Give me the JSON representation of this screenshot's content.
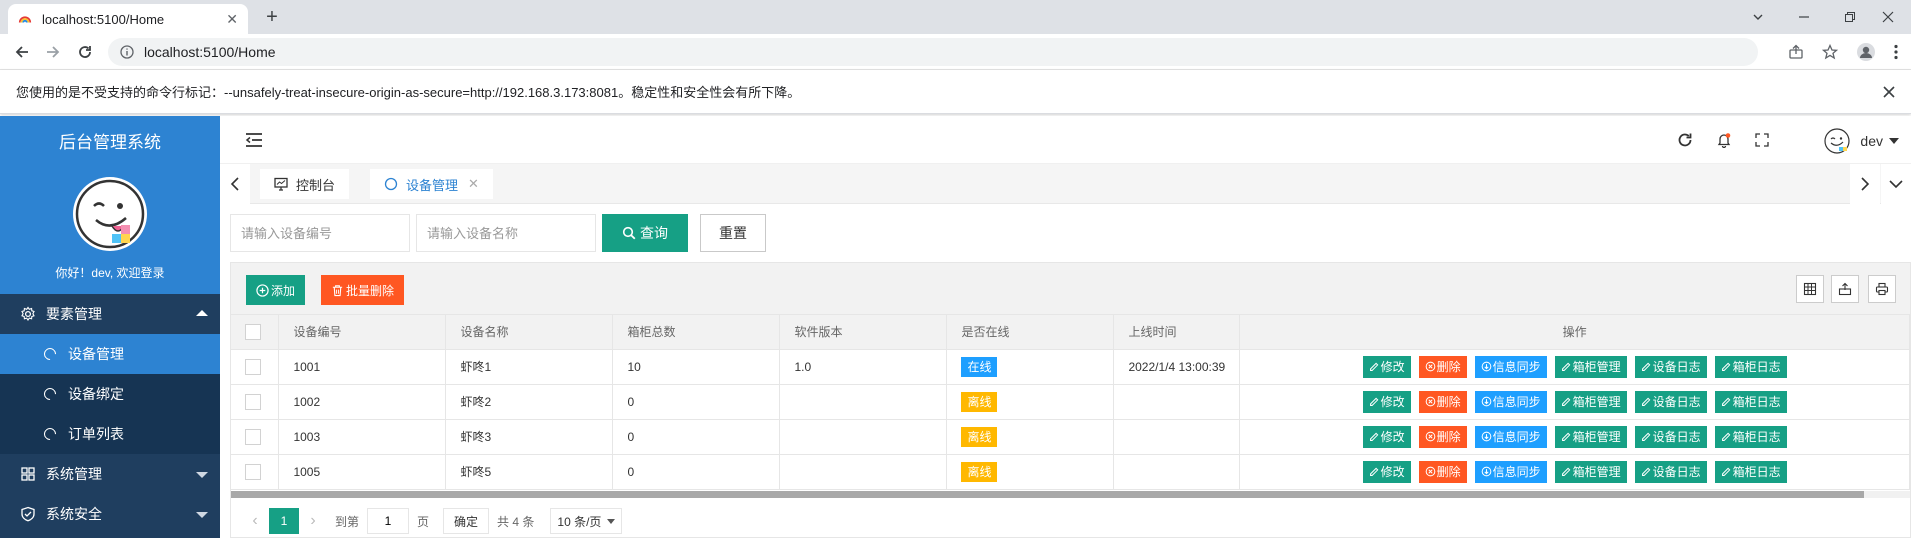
{
  "browser": {
    "tab_title": "localhost:5100/Home",
    "url": "localhost:5100/Home",
    "infobar_text": "您使用的是不受支持的命令行标记：--unsafely-treat-insecure-origin-as-secure=http://192.168.3.173:8081。稳定性和安全性会有所下降。"
  },
  "sidebar": {
    "app_title": "后台管理系统",
    "greeting": "你好！dev, 欢迎登录",
    "groups": [
      {
        "label": "要素管理",
        "expanded": true,
        "items": [
          {
            "label": "设备管理",
            "active": true
          },
          {
            "label": "设备绑定",
            "active": false
          },
          {
            "label": "订单列表",
            "active": false
          }
        ]
      },
      {
        "label": "系统管理",
        "expanded": false
      },
      {
        "label": "系统安全",
        "expanded": false
      }
    ]
  },
  "header": {
    "username": "dev"
  },
  "page_tabs": [
    {
      "label": "控制台",
      "active": false
    },
    {
      "label": "设备管理",
      "active": true,
      "closable": true
    }
  ],
  "search": {
    "code_placeholder": "请输入设备编号",
    "name_placeholder": "请输入设备名称",
    "query_label": "查询",
    "reset_label": "重置"
  },
  "toolbar": {
    "add_label": "添加",
    "batch_delete_label": "批量删除"
  },
  "table": {
    "columns": [
      "设备编号",
      "设备名称",
      "箱柜总数",
      "软件版本",
      "是否在线",
      "上线时间",
      "操作"
    ],
    "rows": [
      {
        "code": "1001",
        "name": "虾咚1",
        "cabinets": "10",
        "version": "1.0",
        "status": "在线",
        "online_time": "2022/1/4 13:00:39"
      },
      {
        "code": "1002",
        "name": "虾咚2",
        "cabinets": "0",
        "version": "",
        "status": "离线",
        "online_time": ""
      },
      {
        "code": "1003",
        "name": "虾咚3",
        "cabinets": "0",
        "version": "",
        "status": "离线",
        "online_time": ""
      },
      {
        "code": "1005",
        "name": "虾咚5",
        "cabinets": "0",
        "version": "",
        "status": "离线",
        "online_time": ""
      }
    ],
    "ops": {
      "edit": "修改",
      "delete": "删除",
      "sync": "信息同步",
      "box": "箱柜管理",
      "dev_log": "设备日志",
      "box_log": "箱柜日志"
    }
  },
  "pager": {
    "current": "1",
    "goto_label": "到第",
    "goto_value": "1",
    "page_label": "页",
    "confirm_label": "确定",
    "total_label": "共 4 条",
    "page_size": "10 条/页"
  },
  "colors": {
    "accent": "#2d83d2",
    "sidebar_bg": "#1f3e5f",
    "primary_green": "#16a085",
    "danger": "#ff5722",
    "info_blue": "#1e9fff",
    "online": "#1e9fff",
    "offline": "#ffb800"
  }
}
